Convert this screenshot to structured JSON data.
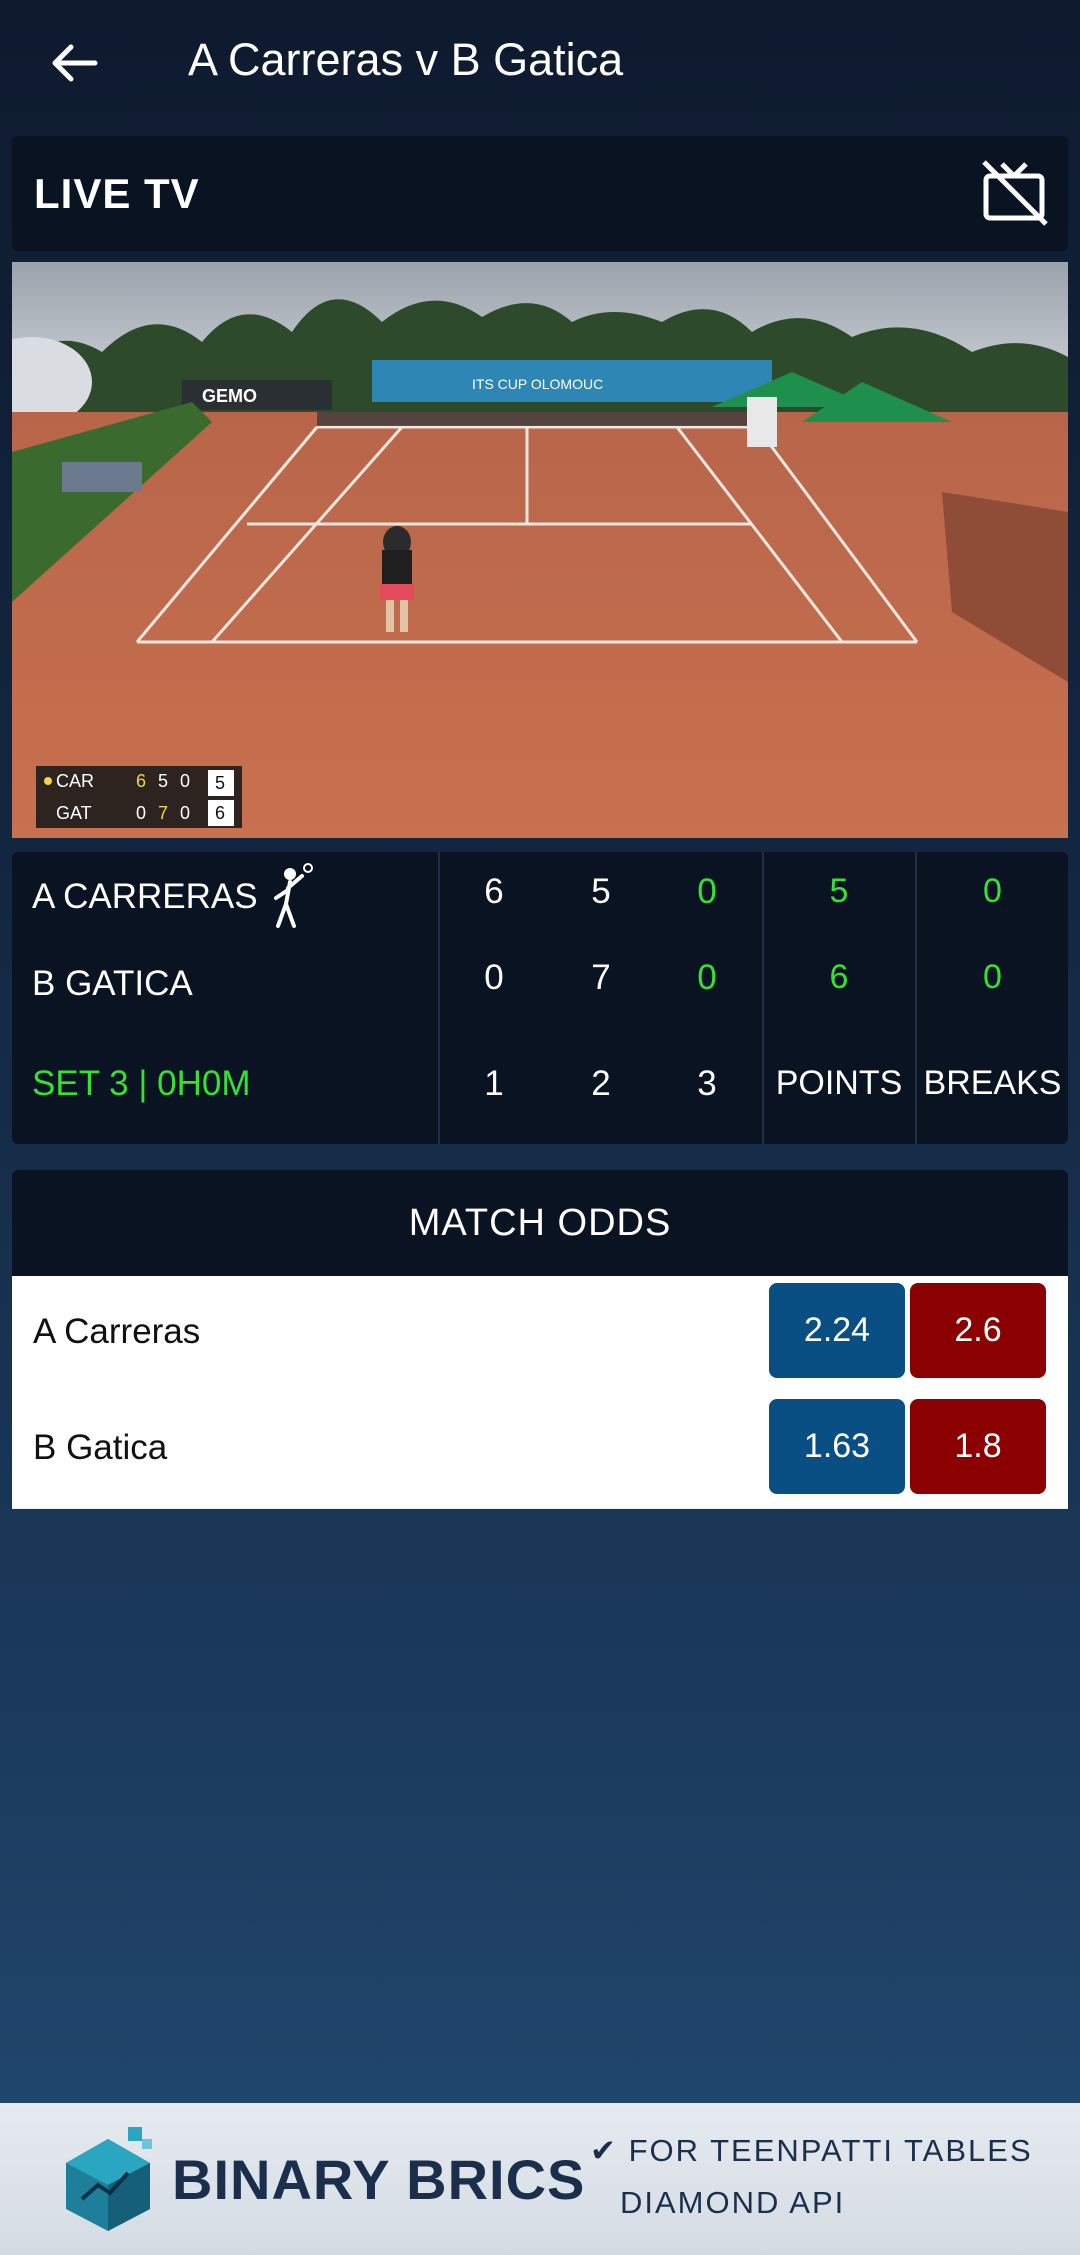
{
  "header": {
    "title": "A Carreras v B Gatica",
    "back_icon": "arrow-left-icon"
  },
  "live_tv": {
    "label": "LIVE TV",
    "icon": "tv-off-icon"
  },
  "video": {
    "overlay": {
      "p1_code": "CAR",
      "p1_s1": "6",
      "p1_s2": "5",
      "p1_s3": "0",
      "p1_pts": "5",
      "p2_code": "GAT",
      "p2_s1": "0",
      "p2_s2": "7",
      "p2_s3": "0",
      "p2_pts": "6"
    },
    "board_text": "ITS CUP OLOMOUC",
    "sponsor_text": "GEMO"
  },
  "scoreboard": {
    "player1": {
      "name": "A CARRERAS",
      "set1": "6",
      "set2": "5",
      "set3": "0",
      "points": "5",
      "breaks": "0",
      "serving_icon": "tennis-player-icon"
    },
    "player2": {
      "name": "B GATICA",
      "set1": "0",
      "set2": "7",
      "set3": "0",
      "points": "6",
      "breaks": "0"
    },
    "status": "SET 3 | 0H0M",
    "col_labels": {
      "c1": "1",
      "c2": "2",
      "c3": "3",
      "points": "POINTS",
      "breaks": "BREAKS"
    }
  },
  "match_odds": {
    "title": "MATCH ODDS",
    "rows": [
      {
        "name": "A Carreras",
        "back": "2.24",
        "lay": "2.6"
      },
      {
        "name": "B Gatica",
        "back": "1.63",
        "lay": "1.8"
      }
    ]
  },
  "banner": {
    "brand": "BINARY BRICS",
    "line1": "✔ FOR TEENPATTI TABLES",
    "line2": "DIAMOND API"
  },
  "colors": {
    "back": "#0a4f84",
    "lay": "#8b0000",
    "live_green": "#33e233",
    "panel": "#0a1322"
  }
}
